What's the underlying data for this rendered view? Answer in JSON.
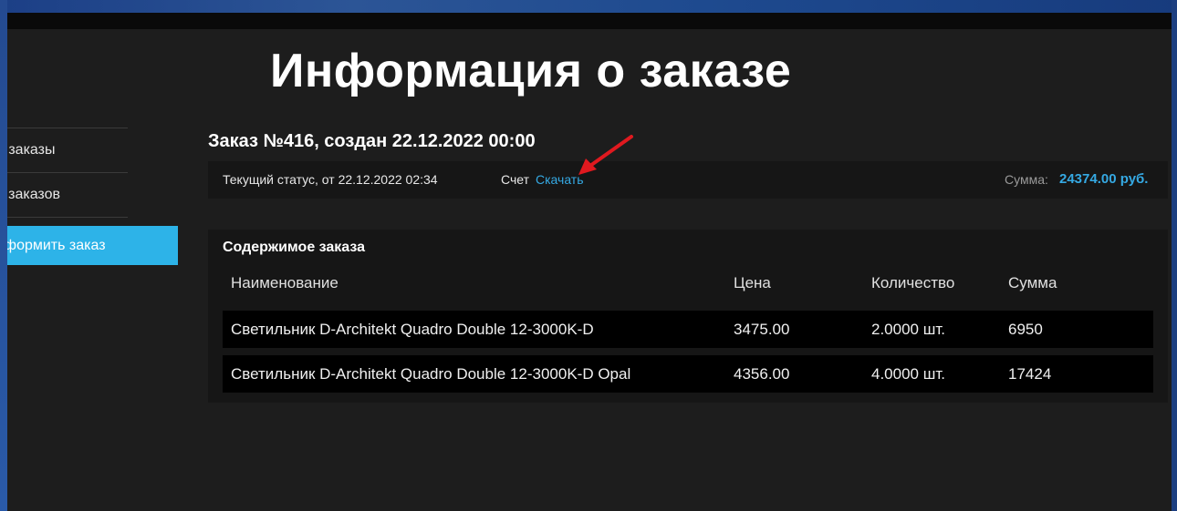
{
  "page": {
    "title": "Информация о заказе"
  },
  "sidebar": {
    "items": [
      {
        "label": "е заказы"
      },
      {
        "label": "я заказов"
      },
      {
        "label": "оформить заказ"
      }
    ]
  },
  "order": {
    "heading": "Заказ №416, создан 22.12.2022 00:00",
    "status_text": "Текущий статус, от 22.12.2022 02:34",
    "invoice_label": "Счет",
    "download_label": "Скачать",
    "sum_label": "Сумма:",
    "sum_value": "24374.00 руб."
  },
  "contents": {
    "title": "Содержимое заказа",
    "columns": [
      "Наименование",
      "Цена",
      "Количество",
      "Сумма"
    ],
    "rows": [
      {
        "name": "Светильник D-Architekt Quadro Double 12-3000K-D",
        "price": "3475.00",
        "qty": "2.0000 шт.",
        "sum": "6950"
      },
      {
        "name": "Светильник D-Architekt Quadro Double 12-3000K-D Opal",
        "price": "4356.00",
        "qty": "4.0000 шт.",
        "sum": "17424"
      }
    ]
  },
  "colors": {
    "accent": "#35a9e3",
    "active_tab": "#2db3e8",
    "annotation_arrow": "#e0191f",
    "background": "#1d1d1d"
  },
  "icons": {
    "annotation": "red-arrow-icon"
  }
}
